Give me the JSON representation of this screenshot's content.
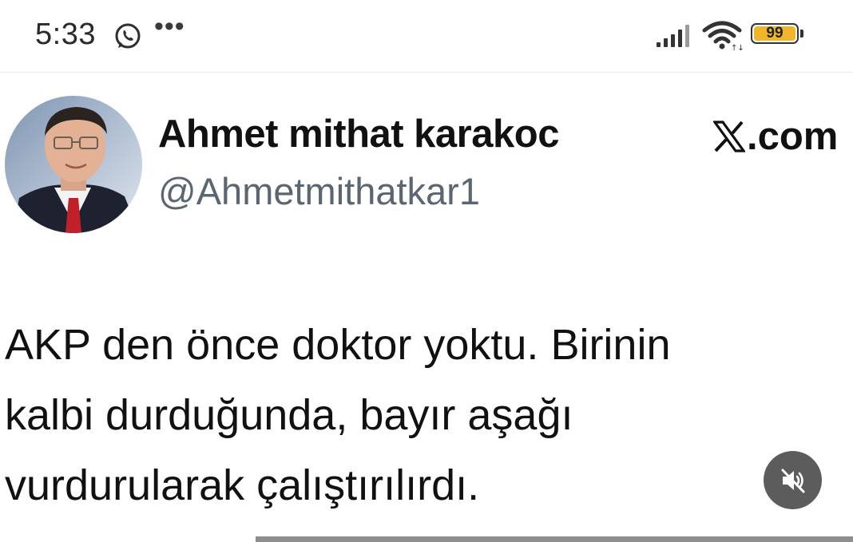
{
  "status_bar": {
    "time": "5:33",
    "notification_icons": [
      "whatsapp-icon",
      "more-dots-icon"
    ],
    "more_text": "•••",
    "signal_icon": "signal-icon",
    "wifi_icon": "wifi-icon",
    "battery_level": "99",
    "battery_color": "#f2b52a"
  },
  "tweet": {
    "author_name": "Ahmet mithat karakoc",
    "author_handle": "@Ahmetmithatkar1",
    "source_logo_text": ".com",
    "source_logo_icon": "x-logo-icon",
    "text_lines": [
      "AKP den önce doktor yoktu. Birinin",
      "kalbi durduğunda, bayır aşağı",
      "vurdurularak çalıştırılırdı."
    ]
  },
  "video_controls": {
    "mute_icon": "speaker-muted-icon",
    "mute_button_color": "#5c5c5c"
  }
}
